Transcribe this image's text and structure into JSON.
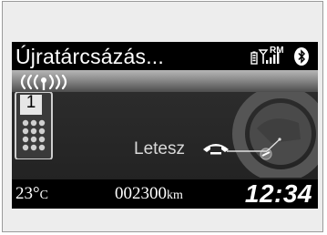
{
  "header": {
    "title": "Újratárcsázás...",
    "signal_badge": "RM"
  },
  "dialer": {
    "phone_slot": "1",
    "action_label": "Letesz"
  },
  "footer": {
    "temperature": "23°",
    "temperature_unit": "C",
    "odometer": "002300",
    "odometer_unit": "km",
    "clock": "12:34"
  }
}
